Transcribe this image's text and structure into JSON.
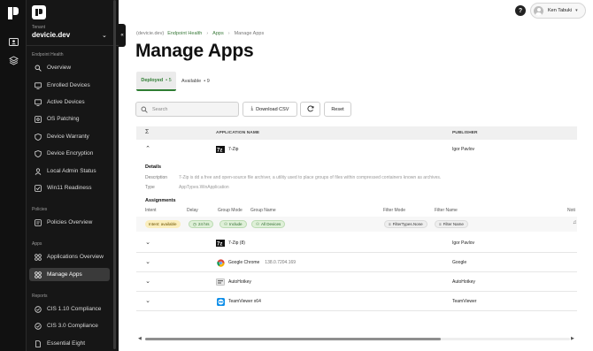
{
  "tenant": {
    "label": "Tenant",
    "name": "devicie.dev"
  },
  "sidebar": {
    "sections": [
      {
        "title": "Endpoint Health",
        "items": [
          {
            "label": "Overview",
            "icon": "search-icon"
          },
          {
            "label": "Enrolled Devices",
            "icon": "monitor-icon"
          },
          {
            "label": "Active Devices",
            "icon": "monitor-icon"
          },
          {
            "label": "OS Patching",
            "icon": "patch-icon"
          },
          {
            "label": "Device Warranty",
            "icon": "shield-icon"
          },
          {
            "label": "Device Encryption",
            "icon": "shield-icon"
          },
          {
            "label": "Local Admin Status",
            "icon": "user-icon"
          },
          {
            "label": "Win11 Readiness",
            "icon": "checkbox-icon"
          }
        ]
      },
      {
        "title": "Policies",
        "items": [
          {
            "label": "Policies Overview",
            "icon": "policy-icon"
          }
        ]
      },
      {
        "title": "Apps",
        "items": [
          {
            "label": "Applications Overview",
            "icon": "grid-icon"
          },
          {
            "label": "Manage Apps",
            "icon": "grid-icon",
            "active": true
          }
        ]
      },
      {
        "title": "Reports",
        "items": [
          {
            "label": "CIS 1.10 Compliance",
            "icon": "shield-check-icon"
          },
          {
            "label": "CIS 3.0 Compliance",
            "icon": "shield-check-icon"
          },
          {
            "label": "Essential Eight",
            "icon": "document-icon"
          }
        ]
      }
    ]
  },
  "topbar": {
    "help": "?",
    "user_name": "Ken Tabuki"
  },
  "breadcrumb": {
    "tenant": "(devicie.dev)",
    "section": "Endpoint Health",
    "apps": "Apps",
    "current": "Manage Apps"
  },
  "page_title": "Manage Apps",
  "tabs": [
    {
      "label": "Deployed",
      "count": "• 5",
      "active": true
    },
    {
      "label": "Available",
      "count": "• 9"
    }
  ],
  "toolbar": {
    "search_placeholder": "Search",
    "download_label": "Download CSV",
    "reset_label": "Reset"
  },
  "table": {
    "headers": {
      "sigma": "Σ",
      "name": "APPLICATION NAME",
      "publisher": "PUBLISHER"
    },
    "rows": [
      {
        "name": "7-Zip",
        "version": "",
        "publisher": "Igor Pavlov",
        "icon": "7zip-icon",
        "expanded": true
      },
      {
        "name": "7-Zip (8)",
        "version": "",
        "publisher": "Igor Pavlov",
        "icon": "7zip-icon"
      },
      {
        "name": "Google Chrome",
        "version": "138.0.7204.169",
        "publisher": "Google",
        "icon": "chrome-icon"
      },
      {
        "name": "AutoHotkey",
        "version": "",
        "publisher": "AutoHotkey",
        "icon": "autohotkey-icon"
      },
      {
        "name": "TeamViewer x64",
        "version": "",
        "publisher": "TeamViewer",
        "icon": "teamviewer-icon"
      }
    ]
  },
  "details": {
    "heading": "Details",
    "description_label": "Description",
    "description": "7-Zip is dd a free and open-source file archiver, a utility used to place groups of files within compressed containers known as archives.",
    "type_label": "Type",
    "type": "AppTypes.WinApplication"
  },
  "assignments": {
    "heading": "Assignments",
    "headers": {
      "intent": "Intent",
      "delay": "Delay",
      "group_mode": "Group Mode",
      "group_name": "Group Name",
      "filter_mode": "Filter Mode",
      "filter_name": "Filter Name",
      "notif": "Noti"
    },
    "row": {
      "intent": "Intent: available",
      "delay": "24 hrs",
      "group_mode": "Include",
      "group_name": "All Devices",
      "filter_mode": "FilterTypes.None",
      "filter_name": "Filter Name"
    }
  }
}
